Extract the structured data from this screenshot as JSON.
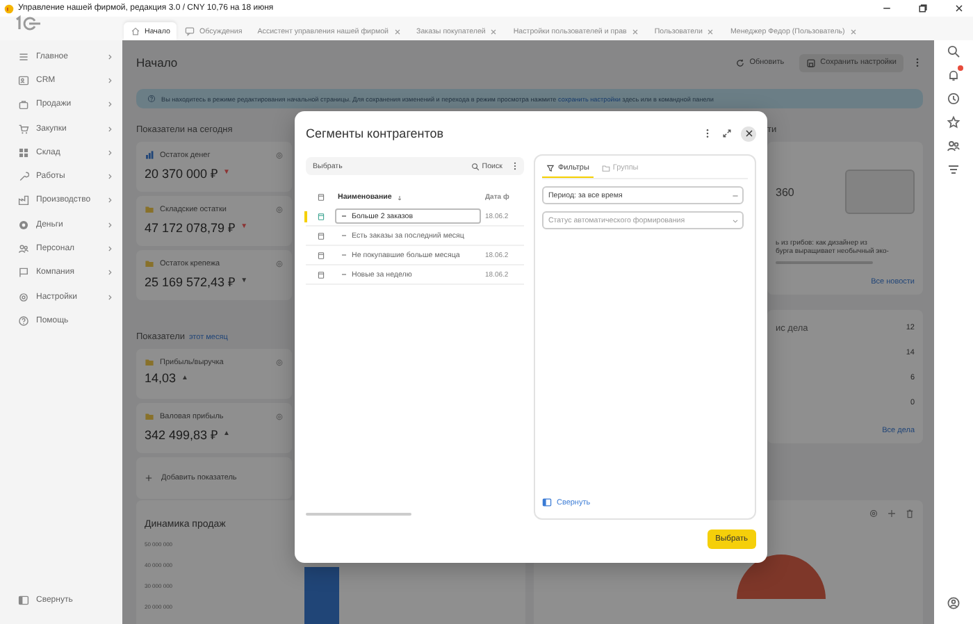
{
  "window": {
    "title": "Управление нашей фирмой, редакция 3.0 / CNY 10,76 на 18 июня"
  },
  "tabs": [
    {
      "label": "Начало",
      "kind": "home",
      "selected": true,
      "closable": false
    },
    {
      "label": "Обсуждения",
      "kind": "chat",
      "selected": false,
      "closable": false
    },
    {
      "label": "Ассистент управления нашей фирмой",
      "kind": "page",
      "selected": false,
      "closable": true
    },
    {
      "label": "Заказы покупателей",
      "kind": "page",
      "selected": false,
      "closable": true
    },
    {
      "label": "Настройки пользователей и прав",
      "kind": "page",
      "selected": false,
      "closable": true
    },
    {
      "label": "Пользователи",
      "kind": "page",
      "selected": false,
      "closable": true
    },
    {
      "label": "Менеджер Федор (Пользователь)",
      "kind": "page",
      "selected": false,
      "closable": true
    }
  ],
  "sidebar": {
    "items": [
      {
        "label": "Главное",
        "expandable": true
      },
      {
        "label": "CRM",
        "expandable": true
      },
      {
        "label": "Продажи",
        "expandable": true
      },
      {
        "label": "Закупки",
        "expandable": true
      },
      {
        "label": "Склад",
        "expandable": true
      },
      {
        "label": "Работы",
        "expandable": true
      },
      {
        "label": "Производство",
        "expandable": true
      },
      {
        "label": "Деньги",
        "expandable": true
      },
      {
        "label": "Персонал",
        "expandable": true
      },
      {
        "label": "Компания",
        "expandable": true
      },
      {
        "label": "Настройки",
        "expandable": true
      },
      {
        "label": "Помощь",
        "expandable": false
      }
    ],
    "collapse": "Свернуть"
  },
  "page": {
    "title": "Начало",
    "actions": [
      {
        "label": "Обновить",
        "kind": "refresh"
      },
      {
        "label": "Сохранить настройки",
        "kind": "save"
      }
    ],
    "banner": {
      "before": "Вы находитесь в режиме редактирования начальной страницы. Для сохранения изменений и перехода в режим просмотра нажмите",
      "link": "сохранить настройки",
      "after": "здесь или в командной панели"
    }
  },
  "today": {
    "title": "Показатели на сегодня",
    "cards": [
      {
        "title": "Остаток денег",
        "value": "20 370 000 ₽",
        "kind": "chart",
        "trend": "▼",
        "color": "#8c3434"
      },
      {
        "title": "Складские остатки",
        "value": "47 172 078,79 ₽",
        "kind": "folder",
        "trend": "▼",
        "color": "#8c3434"
      },
      {
        "title": "Остаток крепежа",
        "value": "25 169 572,43 ₽",
        "kind": "folder",
        "trend": "▼",
        "color": "#333333"
      }
    ]
  },
  "month": {
    "title": "Показатели",
    "period": "этот месяц",
    "cards": [
      {
        "title": "Прибыль/выручка",
        "value": "14,03",
        "kind": "folder",
        "trend": "▲",
        "color": "#333333"
      },
      {
        "title": "Валовая прибыль",
        "value": "342 499,83 ₽",
        "kind": "folder",
        "trend": "▲",
        "color": "#333333"
      }
    ],
    "add": "Добавить показатель"
  },
  "sales": {
    "title": "Динамика продаж",
    "axis_labels": [
      "50 000 000",
      "40 000 000",
      "30 000 000",
      "20 000 000"
    ]
  },
  "news": {
    "heading": "ти",
    "figure": "360",
    "snippet_lines": [
      "ь из грибов: как дизайнер из",
      "бурга выращивает необычный эко-"
    ],
    "all_link": "Все новости"
  },
  "tasks": {
    "heading": "ис дела",
    "total": "12",
    "counts": [
      "14",
      "6",
      "0"
    ],
    "all_link": "Все дела"
  },
  "dialog": {
    "title": "Сегменты контрагентов",
    "toolbar": {
      "choose": "Выбрать",
      "search": "Поиск"
    },
    "columns": [
      "Наименование",
      "Дата ф"
    ],
    "rows": [
      {
        "name": "Больше 2 заказов",
        "date": "18.06.2",
        "selected": true
      },
      {
        "name": "Есть заказы за последний месяц",
        "selected": false
      },
      {
        "name": "Не покупавшие больше месяца",
        "date": "18.06.2",
        "selected": false
      },
      {
        "name": "Новые за неделю",
        "date": "18.06.2",
        "selected": false
      }
    ],
    "filter_tabs": [
      {
        "label": "Фильтры",
        "kind": "filter",
        "selected": true
      },
      {
        "label": "Группы",
        "kind": "folder",
        "selected": false
      }
    ],
    "period": {
      "value": "Период: за все время"
    },
    "status": {
      "placeholder": "Статус автоматического формирования"
    },
    "collapse": "Свернуть",
    "submit": "Выбрать"
  }
}
